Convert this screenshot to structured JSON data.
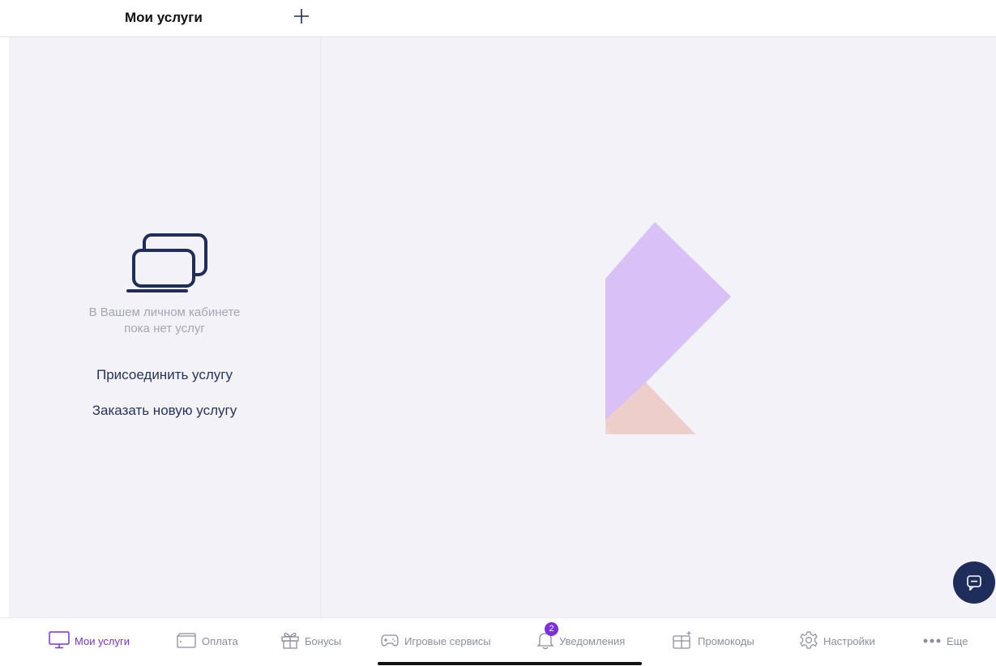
{
  "header": {
    "title": "Мои услуги",
    "add_icon": "plus-icon"
  },
  "empty_state": {
    "icon": "devices-icon",
    "message_line1": "В Вашем личном кабинете",
    "message_line2": "пока нет услуг",
    "attach_link": "Присоединить услугу",
    "order_link": "Заказать новую услугу"
  },
  "chat": {
    "icon": "chat-icon"
  },
  "tabs": [
    {
      "label": "Мои услуги",
      "icon": "monitor-icon",
      "active": true
    },
    {
      "label": "Оплата",
      "icon": "wallet-icon"
    },
    {
      "label": "Бонусы",
      "icon": "gift-icon"
    },
    {
      "label": "Игровые сервисы",
      "icon": "gamepad-icon"
    },
    {
      "label": "Уведомления",
      "icon": "bell-icon",
      "badge": "2"
    },
    {
      "label": "Промокоды",
      "icon": "promo-gift-icon"
    },
    {
      "label": "Настройки",
      "icon": "gear-icon"
    },
    {
      "label": "Еще",
      "icon": "more-dots-icon"
    }
  ],
  "colors": {
    "accent": "#7b2fe0",
    "navy": "#1f2d5a",
    "panel_bg": "#f2f2f7",
    "logo_purple": "#d7c1f7",
    "logo_peach": "#f0cfc4"
  }
}
